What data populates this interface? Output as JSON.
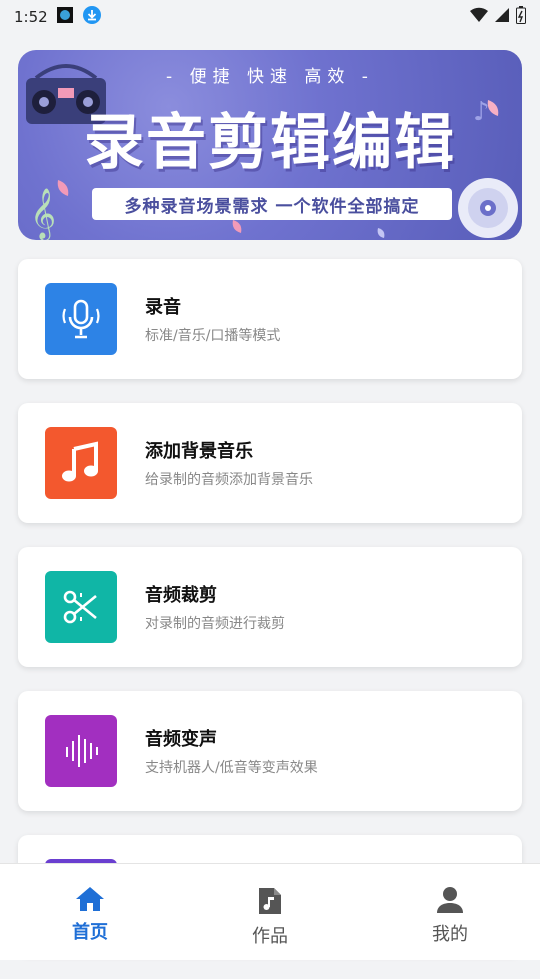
{
  "status": {
    "time": "1:52"
  },
  "banner": {
    "tagline": "- 便捷 快速 高效 -",
    "title": "录音剪辑编辑",
    "subtitle": "多种录音场景需求  一个软件全部搞定"
  },
  "cards": [
    {
      "title": "录音",
      "desc": "标准/音乐/口播等模式",
      "color": "#2d83e6",
      "icon": "microphone-icon"
    },
    {
      "title": "添加背景音乐",
      "desc": "给录制的音频添加背景音乐",
      "color": "#f3582e",
      "icon": "music-note-icon"
    },
    {
      "title": "音频裁剪",
      "desc": "对录制的音频进行裁剪",
      "color": "#10b6a6",
      "icon": "scissors-icon"
    },
    {
      "title": "音频变声",
      "desc": "支持机器人/低音等变声效果",
      "color": "#a22fc0",
      "icon": "sound-wave-icon"
    }
  ],
  "nav": [
    {
      "label": "首页",
      "icon": "home-icon",
      "active": true
    },
    {
      "label": "作品",
      "icon": "music-file-icon",
      "active": false
    },
    {
      "label": "我的",
      "icon": "person-icon",
      "active": false
    }
  ],
  "colors": {
    "accent": "#1f6fd6",
    "background": "#f2f3f5"
  }
}
